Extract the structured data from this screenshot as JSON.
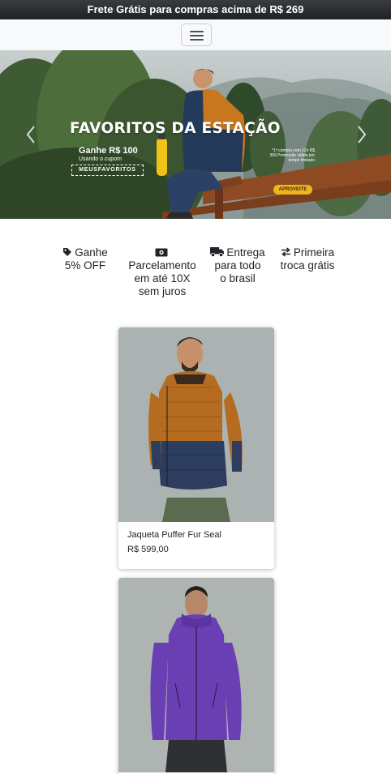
{
  "promo_bar": {
    "text": "Frete Grátis para compras acima de R$ 269"
  },
  "navbar": {
    "menu_icon": "hamburger-menu-icon"
  },
  "hero": {
    "title": "FAVORITOS DA ESTAÇÃO",
    "bonus": "Ganhe R$ 100",
    "coupon_note": "Usando o cupom",
    "coupon_code": "MEUSFAVORITOS",
    "fine_print": "*1ª compra com 12x R$ 399 Promoção válida por tempo limitado",
    "cta": "APROVEITE",
    "prev_icon": "chevron-left-icon",
    "next_icon": "chevron-right-icon"
  },
  "benefits": [
    {
      "icon": "tag-icon",
      "lines": [
        "Ganhe",
        "5% OFF"
      ]
    },
    {
      "icon": "money-bill-icon",
      "lines": [
        "Parcelamento",
        "em até 10X",
        "sem juros"
      ]
    },
    {
      "icon": "truck-icon",
      "lines": [
        "Entrega",
        "para todo",
        "o brasil"
      ]
    },
    {
      "icon": "exchange-arrows-icon",
      "lines": [
        "Primeira",
        "troca grátis"
      ]
    }
  ],
  "products": [
    {
      "name": "Jaqueta Puffer Fur Seal",
      "price": "R$ 599,00",
      "jacket_colors": [
        "#b86f22",
        "#2c3c5e"
      ]
    },
    {
      "name": "",
      "price": "",
      "jacket_colors": [
        "#6a3fb3"
      ]
    }
  ],
  "colors": {
    "cta": "#f2b41e",
    "topbar": "#2a2d30"
  }
}
